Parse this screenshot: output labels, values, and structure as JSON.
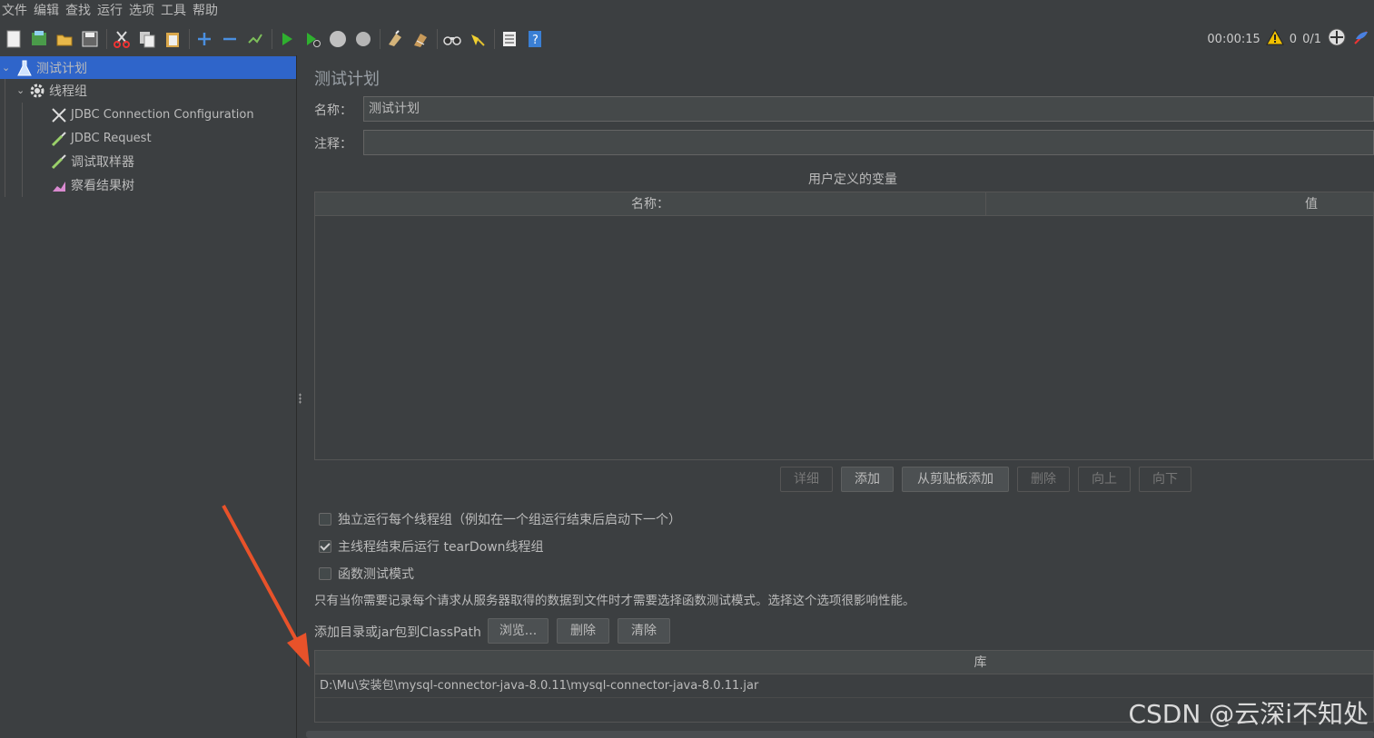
{
  "menu": [
    "文件",
    "编辑",
    "查找",
    "运行",
    "选项",
    "工具",
    "帮助"
  ],
  "toolbar": {
    "timer": "00:00:15",
    "warning_count": "0",
    "thread_count": "0/1"
  },
  "tree": {
    "items": [
      {
        "label": "测试计划",
        "icon": "flask-icon"
      },
      {
        "label": "线程组",
        "icon": "gear-icon"
      },
      {
        "label": "JDBC Connection Configuration",
        "icon": "wrench-screwdriver-icon"
      },
      {
        "label": "JDBC Request",
        "icon": "pipette-icon"
      },
      {
        "label": "调试取样器",
        "icon": "pipette-icon"
      },
      {
        "label": "察看结果树",
        "icon": "chart-icon"
      }
    ]
  },
  "main": {
    "title": "测试计划",
    "name_label": "名称：",
    "name_value": "测试计划",
    "comment_label": "注释：",
    "comment_value": "",
    "vars_title": "用户定义的变量",
    "vars_columns": [
      "名称：",
      "值"
    ],
    "buttons": {
      "detail": "详细",
      "add": "添加",
      "add_clipboard": "从剪贴板添加",
      "delete": "删除",
      "up": "向上",
      "down": "向下"
    },
    "checks": [
      {
        "label": "独立运行每个线程组（例如在一个组运行结束后启动下一个）",
        "checked": false
      },
      {
        "label": "主线程结束后运行 tearDown线程组",
        "checked": true
      },
      {
        "label": "函数测试模式",
        "checked": false
      }
    ],
    "functional_note": "只有当你需要记录每个请求从服务器取得的数据到文件时才需要选择函数测试模式。选择这个选项很影响性能。",
    "classpath_label": "添加目录或jar包到ClassPath",
    "classpath_buttons": {
      "browse": "浏览...",
      "delete": "删除",
      "clear": "清除"
    },
    "lib_header": "库",
    "lib_rows": [
      "D:\\Mu\\安装包\\mysql-connector-java-8.0.11\\mysql-connector-java-8.0.11.jar"
    ]
  },
  "watermark": "CSDN @云深i不知处",
  "colors": {
    "selection": "#2f65ca",
    "arrow": "#e8522a",
    "background": "#3c3f41"
  }
}
